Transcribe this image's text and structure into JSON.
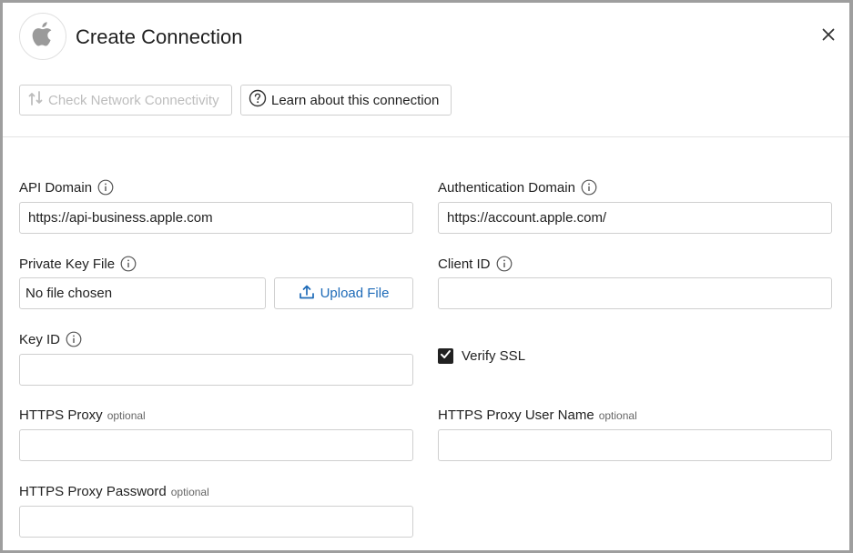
{
  "dialog": {
    "title": "Create Connection",
    "logo_icon": "apple-logo-icon",
    "close_icon": "close-icon"
  },
  "toolbar": {
    "check_network_label": "Check Network Connectivity",
    "check_network_icon": "network-check-icon",
    "learn_label": "Learn about this connection",
    "learn_icon": "question-circle-icon"
  },
  "form": {
    "optional_text": "optional",
    "api_domain": {
      "label": "API Domain",
      "value": "https://api-business.apple.com"
    },
    "auth_domain": {
      "label": "Authentication Domain",
      "value": "https://account.apple.com/"
    },
    "private_key_file": {
      "label": "Private Key File",
      "value": "No file chosen",
      "upload_label": "Upload File"
    },
    "client_id": {
      "label": "Client ID",
      "value": ""
    },
    "key_id": {
      "label": "Key ID",
      "value": ""
    },
    "verify_ssl": {
      "label": "Verify SSL",
      "checked": true
    },
    "https_proxy": {
      "label": "HTTPS Proxy",
      "value": ""
    },
    "https_proxy_user": {
      "label": "HTTPS Proxy User Name",
      "value": ""
    },
    "https_proxy_password": {
      "label": "HTTPS Proxy Password",
      "value": ""
    }
  },
  "colors": {
    "accent": "#1e6bb8",
    "disabled_text": "#bdbdbd",
    "border": "#cfcfcf",
    "checkbox": "#212121"
  }
}
